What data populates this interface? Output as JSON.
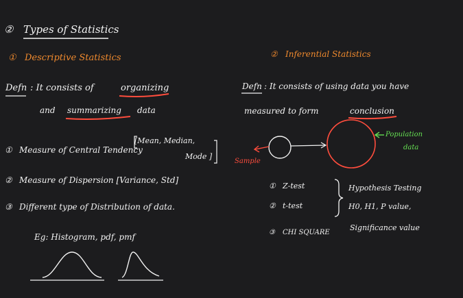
{
  "heading": {
    "number": "②",
    "title": "Types of Statistics"
  },
  "descriptive": {
    "number": "①",
    "title": "Descriptive Statistics",
    "defn_label": "Defn",
    "defn_line1_prefix": ": It consists of",
    "defn_line1_key": "organizing",
    "defn_line2_prefix": "and",
    "defn_line2_key": "summarizing",
    "defn_line2_suffix": "data",
    "bracket_line1": "[Mean, Median,",
    "bracket_line2": "Mode ]",
    "items": [
      {
        "num": "①",
        "text": "Measure of Central Tendency"
      },
      {
        "num": "②",
        "text": "Measure of Dispersion [Variance, Std]"
      },
      {
        "num": "③",
        "text": "Different type of Distribution of data."
      }
    ],
    "example": "Eg: Histogram, pdf, pmf"
  },
  "inferential": {
    "number": "②",
    "title": "Inferential Statistics",
    "defn_label": "Defn",
    "defn_line1": ": It consists of using data you have",
    "defn_line2_prefix": "measured to form",
    "defn_line2_key": "conclusion",
    "sample_label": "Sample",
    "population_label_1": "Population",
    "population_label_2": "data",
    "tests": [
      {
        "num": "①",
        "text": "Z-test"
      },
      {
        "num": "②",
        "text": "t-test"
      },
      {
        "num": "③",
        "text": "CHI SQUARE"
      }
    ],
    "notes": [
      "Hypothesis Testing",
      "H0, H1, P value,",
      "Significance value"
    ]
  },
  "colors": {
    "background": "#1c1c1e",
    "ink": "#f3f3f3",
    "orange": "#f08a2e",
    "red": "#ff4d3d",
    "green": "#65df52"
  }
}
